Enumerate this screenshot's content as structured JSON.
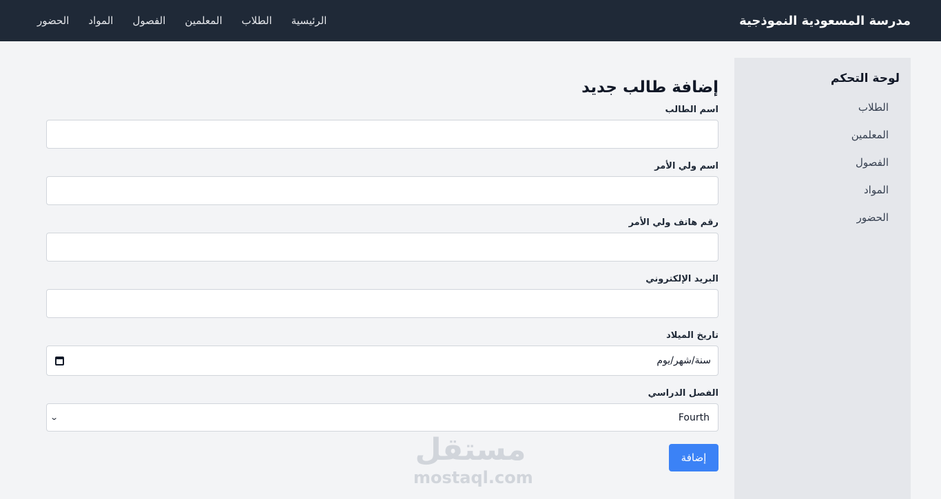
{
  "navbar": {
    "brand": "مدرسة المسعودية النموذجية",
    "links": [
      "الرئيسية",
      "الطلاب",
      "المعلمين",
      "الفصول",
      "المواد",
      "الحضور"
    ]
  },
  "sidebar": {
    "title": "لوحة التحكم",
    "items": [
      "الطلاب",
      "المعلمين",
      "الفصول",
      "المواد",
      "الحضور"
    ]
  },
  "form": {
    "title": "إضافة طالب جديد",
    "student_name_label": "اسم الطالب",
    "student_name_value": "",
    "guardian_name_label": "اسم ولي الأمر",
    "guardian_name_value": "",
    "guardian_phone_label": "رقم هاتف ولي الأمر",
    "guardian_phone_value": "",
    "email_label": "البريد الإلكتروني",
    "email_value": "",
    "birthdate_label": "تاريخ الميلاد",
    "birthdate_value": "سنة/شهر/يوم",
    "class_label": "الفصل الدراسي",
    "class_selected": "Fourth",
    "submit_label": "إضافة"
  },
  "watermark": {
    "arabic": "مستقل",
    "latin": "mostaql.com"
  },
  "colors": {
    "navbar_bg": "#1f2937",
    "sidebar_bg": "#e5e7eb",
    "page_bg": "#f3f4f6",
    "primary": "#3b82f6"
  }
}
